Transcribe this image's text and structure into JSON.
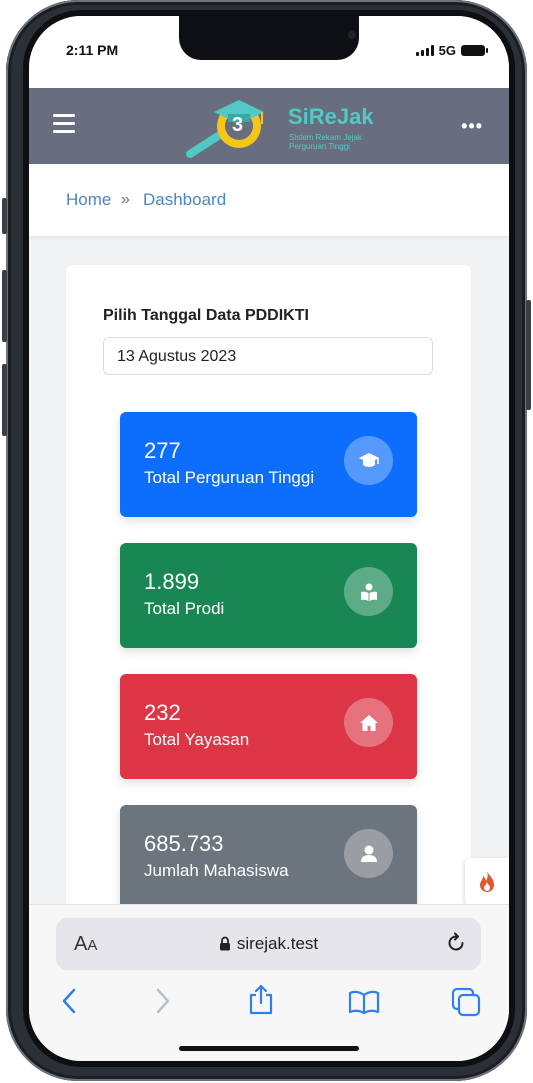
{
  "status_bar": {
    "time": "2:11 PM",
    "network": "5G"
  },
  "navbar": {
    "logo_title": "SiReJak",
    "logo_subtitle_line1": "Sistem Rekam Jejak",
    "logo_subtitle_line2": "Perguruan Tinggi",
    "logo_badge": "3"
  },
  "breadcrumb": {
    "home": "Home",
    "separator": "»",
    "current": "Dashboard"
  },
  "date_picker": {
    "label": "Pilih Tanggal Data PDDIKTI",
    "value": "13 Agustus 2023"
  },
  "stats": [
    {
      "value": "277",
      "label": "Total Perguruan Tinggi",
      "icon": "graduation-cap-icon",
      "color": "#0d6efd"
    },
    {
      "value": "1.899",
      "label": "Total Prodi",
      "icon": "reader-icon",
      "color": "#198754"
    },
    {
      "value": "232",
      "label": "Total Yayasan",
      "icon": "home-icon",
      "color": "#dc3545"
    },
    {
      "value": "685.733",
      "label": "Jumlah Mahasiswa",
      "icon": "user-icon",
      "color": "#6c757d"
    }
  ],
  "safari": {
    "url": "sirejak.test",
    "text_size_label_big": "A",
    "text_size_label_small": "A"
  },
  "colors": {
    "navbar": "#686e80",
    "accent": "#52c9c4",
    "link": "#4a86c4"
  }
}
